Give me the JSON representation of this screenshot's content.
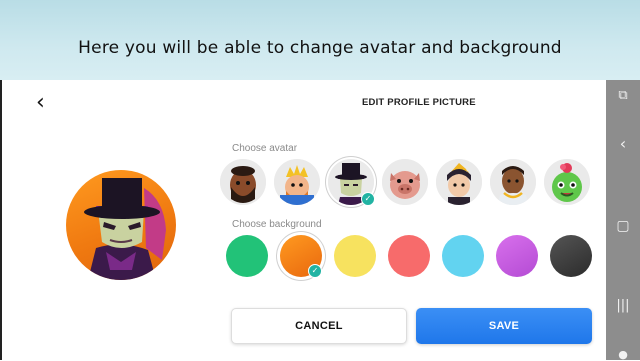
{
  "banner": {
    "text": "Here you will be able to change avatar and background"
  },
  "header": {
    "title": "EDIT PROFILE PICTURE"
  },
  "sections": {
    "avatar_label": "Choose avatar",
    "background_label": "Choose background"
  },
  "avatars": [
    {
      "name": "bearded-brawler"
    },
    {
      "name": "king"
    },
    {
      "name": "mortis-top-hat",
      "selected": true
    },
    {
      "name": "pig"
    },
    {
      "name": "dark-haired-kid"
    },
    {
      "name": "boy-with-necklace"
    },
    {
      "name": "spike-cactus"
    }
  ],
  "backgrounds": [
    {
      "color": "#22c278"
    },
    {
      "color": "#f47d13",
      "selected": true
    },
    {
      "color": "#f7e25f"
    },
    {
      "color": "#f76b6b"
    },
    {
      "color": "#62d3f0"
    },
    {
      "color": "#c65be0"
    },
    {
      "color": "#3a3a3a"
    }
  ],
  "buttons": {
    "cancel": "CANCEL",
    "save": "SAVE"
  },
  "colors": {
    "accent": "#2b82f0",
    "check": "#22b3a3"
  }
}
